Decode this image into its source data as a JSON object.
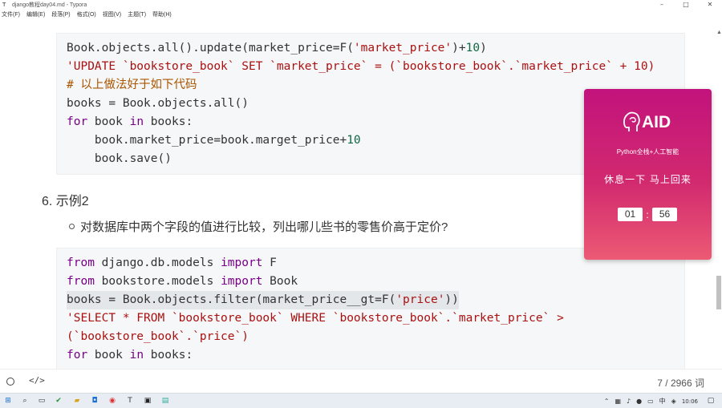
{
  "window": {
    "title": "django教程day04.md - Typora",
    "app_icon": "T",
    "controls": [
      "–",
      "□",
      "✕"
    ]
  },
  "menu": [
    "文件(F)",
    "编辑(E)",
    "段落(P)",
    "格式(O)",
    "视图(V)",
    "主题(T)",
    "帮助(H)"
  ],
  "code_block_1": {
    "lines": [
      [
        {
          "t": "Book.objects.all().update(market_price=F(",
          "c": ""
        },
        {
          "t": "'market_price'",
          "c": "str"
        },
        {
          "t": ")+",
          "c": ""
        },
        {
          "t": "10",
          "c": "num"
        },
        {
          "t": ")",
          "c": ""
        }
      ],
      [
        {
          "t": "'UPDATE `bookstore_book` SET `market_price` = (`bookstore_book`.`market_price` + 10)",
          "c": "str"
        }
      ],
      [
        {
          "t": "# 以上做法好于如下代码",
          "c": "cmt"
        }
      ],
      [
        {
          "t": "books = Book.objects.all()",
          "c": ""
        }
      ],
      [
        {
          "t": "for",
          "c": "kw"
        },
        {
          "t": " book ",
          "c": ""
        },
        {
          "t": "in",
          "c": "kw"
        },
        {
          "t": " books:",
          "c": ""
        }
      ],
      [
        {
          "t": "    book.market_price=book.marget_price+",
          "c": ""
        },
        {
          "t": "10",
          "c": "num"
        }
      ],
      [
        {
          "t": "    book.save()",
          "c": ""
        }
      ]
    ]
  },
  "heading": "6. 示例2",
  "bullet_text": "对数据库中两个字段的值进行比较，列出哪儿些书的零售价高于定价?",
  "code_block_2": {
    "lines": [
      [
        {
          "t": "from",
          "c": "kw"
        },
        {
          "t": " django.db.models ",
          "c": ""
        },
        {
          "t": "import",
          "c": "kw"
        },
        {
          "t": " F",
          "c": ""
        }
      ],
      [
        {
          "t": "from",
          "c": "kw"
        },
        {
          "t": " bookstore.models ",
          "c": ""
        },
        {
          "t": "import",
          "c": "kw"
        },
        {
          "t": " Book",
          "c": ""
        }
      ],
      [
        {
          "t": "books = Book.objects.filter(market_price__gt=F(",
          "c": ""
        },
        {
          "t": "'price'",
          "c": "str"
        },
        {
          "t": "))",
          "c": ""
        }
      ],
      [
        {
          "t": "'SELECT * FROM `bookstore_book` WHERE `bookstore_book`.`market_price` >",
          "c": "str"
        }
      ],
      [
        {
          "t": "(`bookstore_book`.`price`)",
          "c": "str"
        }
      ],
      [
        {
          "t": "for",
          "c": "kw"
        },
        {
          "t": " book ",
          "c": ""
        },
        {
          "t": "in",
          "c": "kw"
        },
        {
          "t": " books:",
          "c": ""
        }
      ]
    ]
  },
  "timer": {
    "logo_text": "AID",
    "subtitle": "Python全栈+人工智能",
    "rest_text": "休息一下  马上回来",
    "minutes": "01",
    "separator": ":",
    "seconds": "56"
  },
  "status": {
    "word_count": "7 / 2966 词"
  },
  "taskbar": {
    "clock": "10:06"
  },
  "colors": {
    "keyword": "#770088",
    "string": "#aa1111",
    "number": "#116644",
    "comment": "#aa5500",
    "timer_top": "#c2137c",
    "timer_bottom": "#ec5a74"
  }
}
